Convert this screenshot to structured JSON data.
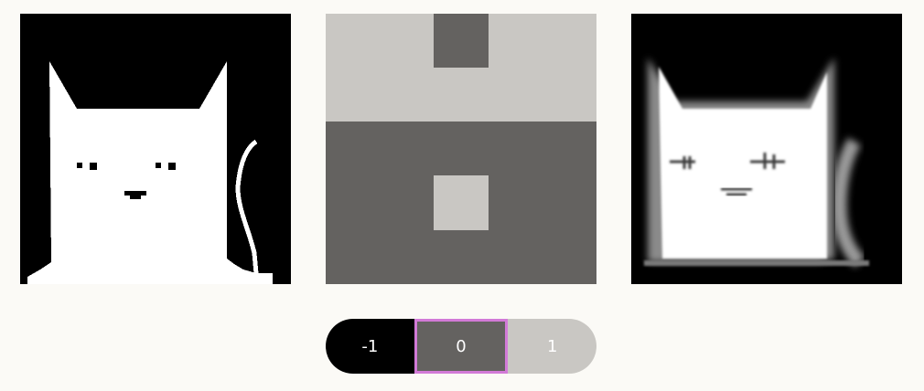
{
  "colors": {
    "background": "#fbfaf6",
    "kernel_light": "#c9c7c3",
    "kernel_dark": "#646260",
    "selection_outline": "#d27ad7"
  },
  "panels": [
    {
      "name": "input-image",
      "icon": "cat-pixel-art"
    },
    {
      "name": "kernel-filter",
      "icon": "convolution-kernel"
    },
    {
      "name": "output-image",
      "icon": "cat-convolved"
    }
  ],
  "kernel_selector": {
    "selected_index": 1,
    "options": [
      {
        "label": "-1",
        "value": -1,
        "color": "#000000"
      },
      {
        "label": "0",
        "value": 0,
        "color": "#646260"
      },
      {
        "label": "1",
        "value": 1,
        "color": "#c9c7c3"
      }
    ]
  }
}
